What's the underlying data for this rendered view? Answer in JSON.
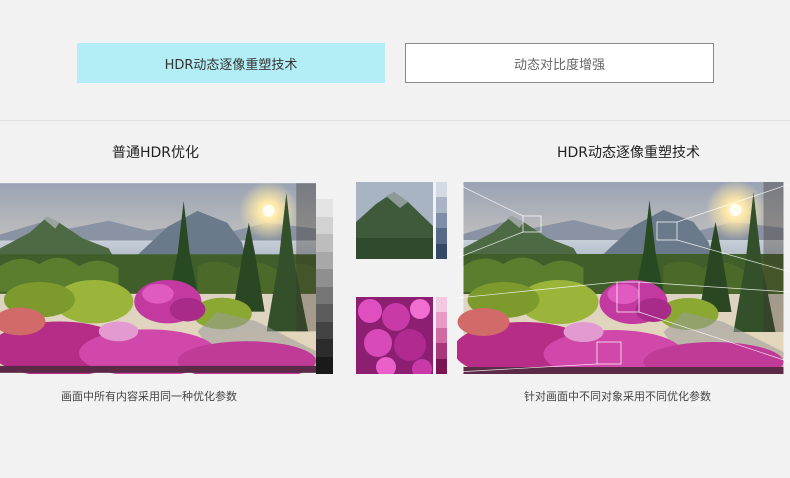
{
  "tabs": {
    "active_label": "HDR动态逐像重塑技术",
    "inactive_label": "动态对比度增强"
  },
  "left_panel": {
    "title": "普通HDR优化",
    "caption": "画面中所有内容采用同一种优化参数",
    "image": "lakeside-garden-photo"
  },
  "right_panel": {
    "title": "HDR动态逐像重塑技术",
    "caption": "针对画面中不同对象采用不同优化参数",
    "image": "lakeside-garden-photo-zoomed"
  },
  "colors": {
    "active_tab_bg": "#b3eef6",
    "inactive_tab_border": "#8a8a8a",
    "page_bg": "#f2f2f2",
    "flower_magenta": "#c23aa0",
    "sky_sun": "#ffe9a8"
  }
}
